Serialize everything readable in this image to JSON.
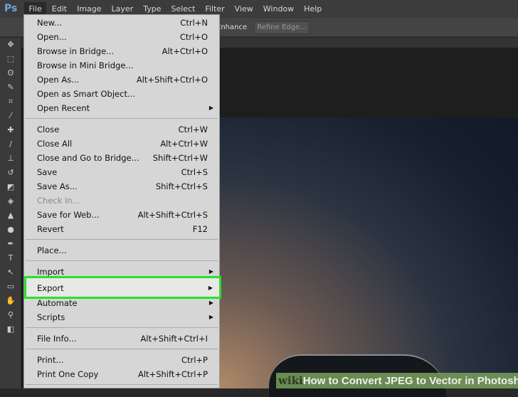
{
  "app": {
    "logo": "Ps"
  },
  "menubar": [
    "File",
    "Edit",
    "Image",
    "Layer",
    "Type",
    "Select",
    "Filter",
    "View",
    "Window",
    "Help"
  ],
  "options": {
    "enhance": "Enhance",
    "refine": "Refine Edge..."
  },
  "tools": [
    "move",
    "marquee",
    "lasso",
    "quick-selection",
    "crop",
    "eyedropper",
    "healing",
    "brush",
    "clone-stamp",
    "history-brush",
    "eraser",
    "paint-bucket",
    "blur",
    "dodge",
    "pen",
    "type",
    "path-selection",
    "rectangle",
    "hand",
    "zoom",
    "colors"
  ],
  "file_menu": [
    {
      "label": "New...",
      "shortcut": "Ctrl+N"
    },
    {
      "label": "Open...",
      "shortcut": "Ctrl+O"
    },
    {
      "label": "Browse in Bridge...",
      "shortcut": "Alt+Ctrl+O"
    },
    {
      "label": "Browse in Mini Bridge..."
    },
    {
      "label": "Open As...",
      "shortcut": "Alt+Shift+Ctrl+O"
    },
    {
      "label": "Open as Smart Object..."
    },
    {
      "label": "Open Recent",
      "submenu": true
    },
    {
      "sep": true
    },
    {
      "label": "Close",
      "shortcut": "Ctrl+W"
    },
    {
      "label": "Close All",
      "shortcut": "Alt+Ctrl+W"
    },
    {
      "label": "Close and Go to Bridge...",
      "shortcut": "Shift+Ctrl+W"
    },
    {
      "label": "Save",
      "shortcut": "Ctrl+S"
    },
    {
      "label": "Save As...",
      "shortcut": "Shift+Ctrl+S"
    },
    {
      "label": "Check In...",
      "disabled": true
    },
    {
      "label": "Save for Web...",
      "shortcut": "Alt+Shift+Ctrl+S"
    },
    {
      "label": "Revert",
      "shortcut": "F12"
    },
    {
      "sep": true
    },
    {
      "label": "Place..."
    },
    {
      "sep": true
    },
    {
      "label": "Import",
      "submenu": true
    },
    {
      "label": "Export",
      "submenu": true,
      "highlighted": true
    },
    {
      "label": "Automate",
      "submenu": true
    },
    {
      "label": "Scripts",
      "submenu": true
    },
    {
      "sep": true
    },
    {
      "label": "File Info...",
      "shortcut": "Alt+Shift+Ctrl+I"
    },
    {
      "sep": true
    },
    {
      "label": "Print...",
      "shortcut": "Ctrl+P"
    },
    {
      "label": "Print One Copy",
      "shortcut": "Alt+Shift+Ctrl+P"
    },
    {
      "sep": true
    }
  ],
  "watermark": {
    "wiki": "wiki",
    "title": "How to Convert JPEG to Vector in Photoshop"
  },
  "colors": {
    "highlight": "#28e028"
  }
}
